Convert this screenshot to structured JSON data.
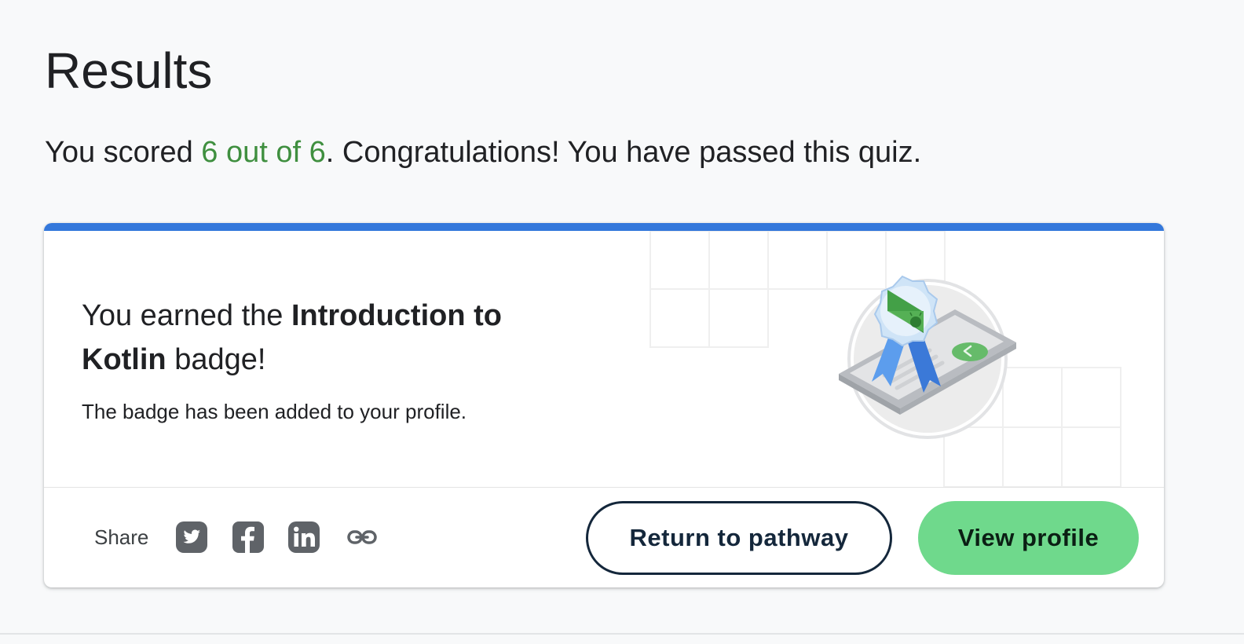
{
  "page": {
    "title": "Results"
  },
  "score": {
    "prefix": "You scored ",
    "value": "6 out of 6",
    "suffix": ". Congratulations! You have passed this quiz.",
    "highlight_color": "#3f8f3f"
  },
  "badge_card": {
    "accent_color": "#3478db",
    "heading_prefix": "You earned the ",
    "badge_name_line1": "Introduction to",
    "badge_name_line2": "Kotlin",
    "heading_suffix": " badge!",
    "description": "The badge has been added to your profile.",
    "illustration": "android-badge-ribbon-illustration"
  },
  "share": {
    "label": "Share",
    "icons": [
      "twitter-icon",
      "facebook-icon",
      "linkedin-icon",
      "link-icon"
    ]
  },
  "actions": {
    "return_label": "Return to pathway",
    "profile_label": "View profile",
    "profile_color": "#6fd98c"
  }
}
